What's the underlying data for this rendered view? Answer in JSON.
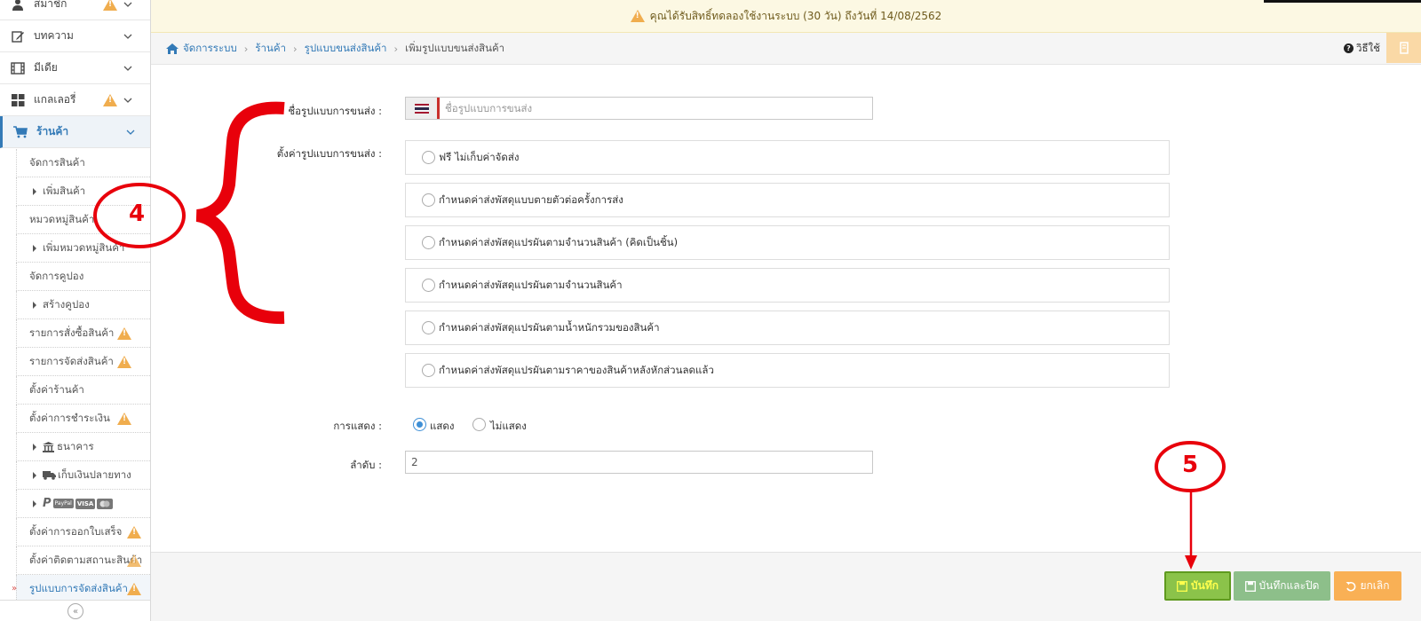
{
  "notice": {
    "text": "คุณได้รับสิทธิ์ทดลองใช้งานระบบ (30 วัน) ถึงวันที่ 14/08/2562"
  },
  "breadcrumb": {
    "items": [
      "จัดการระบบ",
      "ร้านค้า",
      "รูปแบบขนส่งสินค้า"
    ],
    "current": "เพิ่มรูปแบบขนส่งสินค้า"
  },
  "help": {
    "label": "วิธีใช้"
  },
  "sidebar": {
    "items": [
      {
        "label": "สมาชิก",
        "icon": "user-icon",
        "warning": true
      },
      {
        "label": "บทความ",
        "icon": "edit-icon",
        "warning": false
      },
      {
        "label": "มีเดีย",
        "icon": "film-icon",
        "warning": false
      },
      {
        "label": "แกลเลอรี่",
        "icon": "grid-icon",
        "warning": true
      },
      {
        "label": "ร้านค้า",
        "icon": "cart-icon",
        "warning": false
      }
    ],
    "sub": [
      {
        "label": "จัดการสินค้า",
        "level": 1
      },
      {
        "label": "เพิ่มสินค้า",
        "level": 2
      },
      {
        "label": "หมวดหมู่สินค้า",
        "level": 1
      },
      {
        "label": "เพิ่มหมวดหมู่สินค้า",
        "level": 2
      },
      {
        "label": "จัดการคูปอง",
        "level": 1
      },
      {
        "label": "สร้างคูปอง",
        "level": 2
      },
      {
        "label": "รายการสั่งซื้อสินค้า",
        "level": 1,
        "warning": true
      },
      {
        "label": "รายการจัดส่งสินค้า",
        "level": 1,
        "warning": true
      },
      {
        "label": "ตั้งค่าร้านค้า",
        "level": 1
      },
      {
        "label": "ตั้งค่าการชำระเงิน",
        "level": 1,
        "warning": true
      },
      {
        "label": "ธนาคาร",
        "level": 2,
        "icon": "bank-icon"
      },
      {
        "label": "เก็บเงินปลายทาง",
        "level": 2,
        "icon": "truck-icon"
      },
      {
        "label": "",
        "level": 2,
        "icon": "payment-cards-icon"
      },
      {
        "label": "ตั้งค่าการออกใบเสร็จ",
        "level": 1,
        "warning": true
      },
      {
        "label": "ตั้งค่าติดตามสถานะสินค้า",
        "level": 1,
        "warning": true
      },
      {
        "label": "รูปแบบการจัดส่งสินค้า",
        "level": 1,
        "warning": true,
        "current": true
      }
    ],
    "payment_badges": [
      "PayPal",
      "VISA"
    ]
  },
  "form": {
    "name_label": "ชื่อรูปแบบการขนส่ง :",
    "name_placeholder": "ชื่อรูปแบบการขนส่ง",
    "type_label": "ตั้งค่ารูปแบบการขนส่ง :",
    "options": [
      "ฟรี ไม่เก็บค่าจัดส่ง",
      "กำหนดค่าส่งพัสดุแบบตายตัวต่อครั้งการส่ง",
      "กำหนดค่าส่งพัสดุแปรผันตามจำนวนสินค้า (คิดเป็นชิ้น)",
      "กำหนดค่าส่งพัสดุแปรผันตามจำนวนสินค้า",
      "กำหนดค่าส่งพัสดุแปรผันตามน้ำหนักรวมของสินค้า",
      "กำหนดค่าส่งพัสดุแปรผันตามราคาของสินค้าหลังหักส่วนลดแล้ว"
    ],
    "display_label": "การแสดง :",
    "display_show": "แสดง",
    "display_hide": "ไม่แสดง",
    "display_selected": "แสดง",
    "order_label": "ลำดับ :",
    "order_value": "2"
  },
  "buttons": {
    "save": "บันทึก",
    "save_close": "บันทึกและปิด",
    "cancel": "ยกเลิก"
  },
  "annotations": {
    "step4": "4",
    "step5": "5",
    "color": "#e8000b"
  },
  "colors": {
    "primary": "#337ab7",
    "save": "#8bc34a",
    "save_close": "#8dbf8a",
    "cancel": "#f9b055",
    "warning": "#f0ad4e",
    "notice_bg": "#fcf8e3"
  }
}
